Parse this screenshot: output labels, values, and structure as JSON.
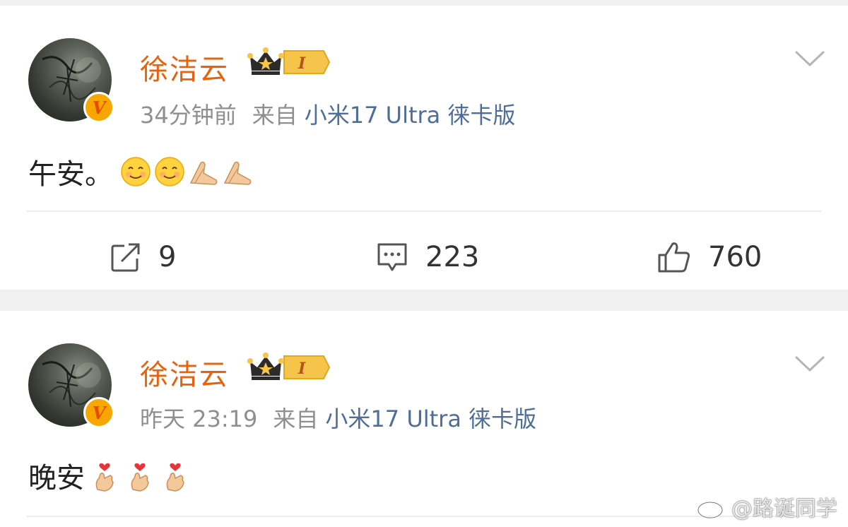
{
  "posts": [
    {
      "author": "徐洁云",
      "vip_level": "I",
      "time": "34分钟前",
      "source_prefix": "来自",
      "device": "小米17 Ultra 徕卡版",
      "text": "午安。",
      "emojis": [
        "smile-emoji",
        "smile-emoji",
        "pray-hands-emoji",
        "pray-hands-emoji"
      ],
      "actions": {
        "repost": "9",
        "comment": "223",
        "like": "760"
      }
    },
    {
      "author": "徐洁云",
      "vip_level": "I",
      "time": "昨天 23:19",
      "source_prefix": "来自",
      "device": "小米17 Ultra 徕卡版",
      "text": "晚安",
      "emojis": [
        "finger-heart-emoji",
        "finger-heart-emoji",
        "finger-heart-emoji"
      ]
    }
  ],
  "watermark": "@路诞同学",
  "colors": {
    "author": "#e8620d",
    "device_link": "#4e6e97",
    "meta_gray": "#8f8f8f",
    "verified_badge": "#f7a700"
  }
}
